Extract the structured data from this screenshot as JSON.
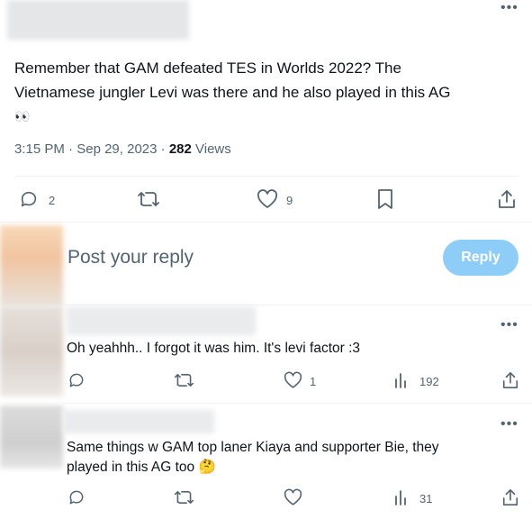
{
  "tweet": {
    "text_line1": "Remember that GAM defeated TES in Worlds 2022? The",
    "text_line2": "Vietnamese jungler Levi was there and he also played in this AG",
    "emoji": "👀",
    "time": "3:15 PM",
    "date": "Sep 29, 2023",
    "sep": "·",
    "views_count": "282",
    "views_label": "Views",
    "stats": {
      "replies": "2",
      "likes": "9"
    }
  },
  "reply_box": {
    "placeholder": "Post your reply",
    "button": "Reply"
  },
  "replies": [
    {
      "text": "Oh yeahhh.. I forgot it was him. It's levi factor :3",
      "likes": "1",
      "views": "192"
    },
    {
      "text_line1": "Same things w GAM top laner Kiaya and supporter Bie, they",
      "text_line2": "played in this AG too",
      "emoji": "🤔",
      "views": "31"
    }
  ],
  "colors": {
    "accent": "#1d9bf0",
    "reply_button_bg": "#8ecdf8",
    "muted": "#536471",
    "divider": "#eff3f4"
  },
  "icons": [
    "more-icon",
    "reply-icon",
    "retweet-icon",
    "like-icon",
    "bookmark-icon",
    "share-icon",
    "views-icon"
  ]
}
